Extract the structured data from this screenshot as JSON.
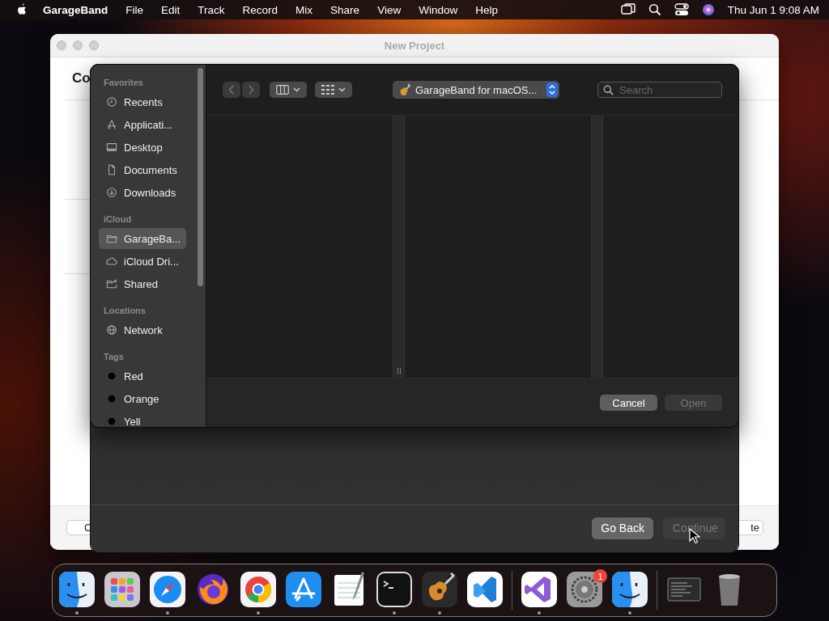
{
  "menu_bar": {
    "app_name": "GarageBand",
    "menus": [
      "File",
      "Edit",
      "Track",
      "Record",
      "Mix",
      "Share",
      "View",
      "Window",
      "Help"
    ],
    "clock": "Thu Jun 1  9:08 AM"
  },
  "back_window": {
    "title": "New Project",
    "heading": "Co",
    "left_button": "C",
    "right_button": "te"
  },
  "sheet": {
    "buttons": [
      {
        "label": "Go Back",
        "disabled": false
      },
      {
        "label": "Continue",
        "disabled": true
      }
    ]
  },
  "open_panel": {
    "sidebar": [
      {
        "title": "Favorites",
        "items": [
          {
            "label": "Recents",
            "kind": "clock",
            "selected": false
          },
          {
            "label": "Applicati...",
            "kind": "apps",
            "selected": false
          },
          {
            "label": "Desktop",
            "kind": "desktop",
            "selected": false
          },
          {
            "label": "Documents",
            "kind": "document",
            "selected": false
          },
          {
            "label": "Downloads",
            "kind": "download",
            "selected": false
          }
        ]
      },
      {
        "title": "iCloud",
        "items": [
          {
            "label": "GarageBa...",
            "kind": "folder",
            "selected": true
          },
          {
            "label": "iCloud Dri...",
            "kind": "cloud",
            "selected": false
          },
          {
            "label": "Shared",
            "kind": "shared",
            "selected": false
          }
        ]
      },
      {
        "title": "Locations",
        "items": [
          {
            "label": "Network",
            "kind": "globe",
            "selected": false
          }
        ]
      },
      {
        "title": "Tags",
        "items": [
          {
            "label": "Red",
            "kind": "tag",
            "color": "#000000",
            "selected": false
          },
          {
            "label": "Orange",
            "kind": "tag",
            "color": "#000000",
            "selected": false
          },
          {
            "label": "Yell",
            "kind": "tag",
            "color": "#000000",
            "selected": false
          }
        ]
      }
    ],
    "location": "GarageBand for macOS...",
    "search": {
      "placeholder": "Search"
    },
    "buttons": [
      {
        "label": "Cancel",
        "disabled": false
      },
      {
        "label": "Open",
        "disabled": true
      }
    ]
  },
  "dock": [
    {
      "kind": "face",
      "running": true
    },
    {
      "kind": "grid",
      "running": false
    },
    {
      "kind": "compass",
      "running": true
    },
    {
      "kind": "fox",
      "running": false
    },
    {
      "kind": "ring",
      "running": true
    },
    {
      "kind": "tools",
      "running": false
    },
    {
      "kind": "notepad",
      "running": false
    },
    {
      "kind": "terminal",
      "running": true
    },
    {
      "kind": "guitar",
      "running": true
    },
    {
      "kind": "bracket",
      "running": false
    },
    {
      "kind": "separator"
    },
    {
      "kind": "loop",
      "running": true
    },
    {
      "kind": "gear",
      "running": false,
      "badge": "1"
    },
    {
      "kind": "face",
      "running": true
    },
    {
      "kind": "separator"
    },
    {
      "kind": "window",
      "running": false
    },
    {
      "kind": "trash",
      "running": false
    }
  ]
}
